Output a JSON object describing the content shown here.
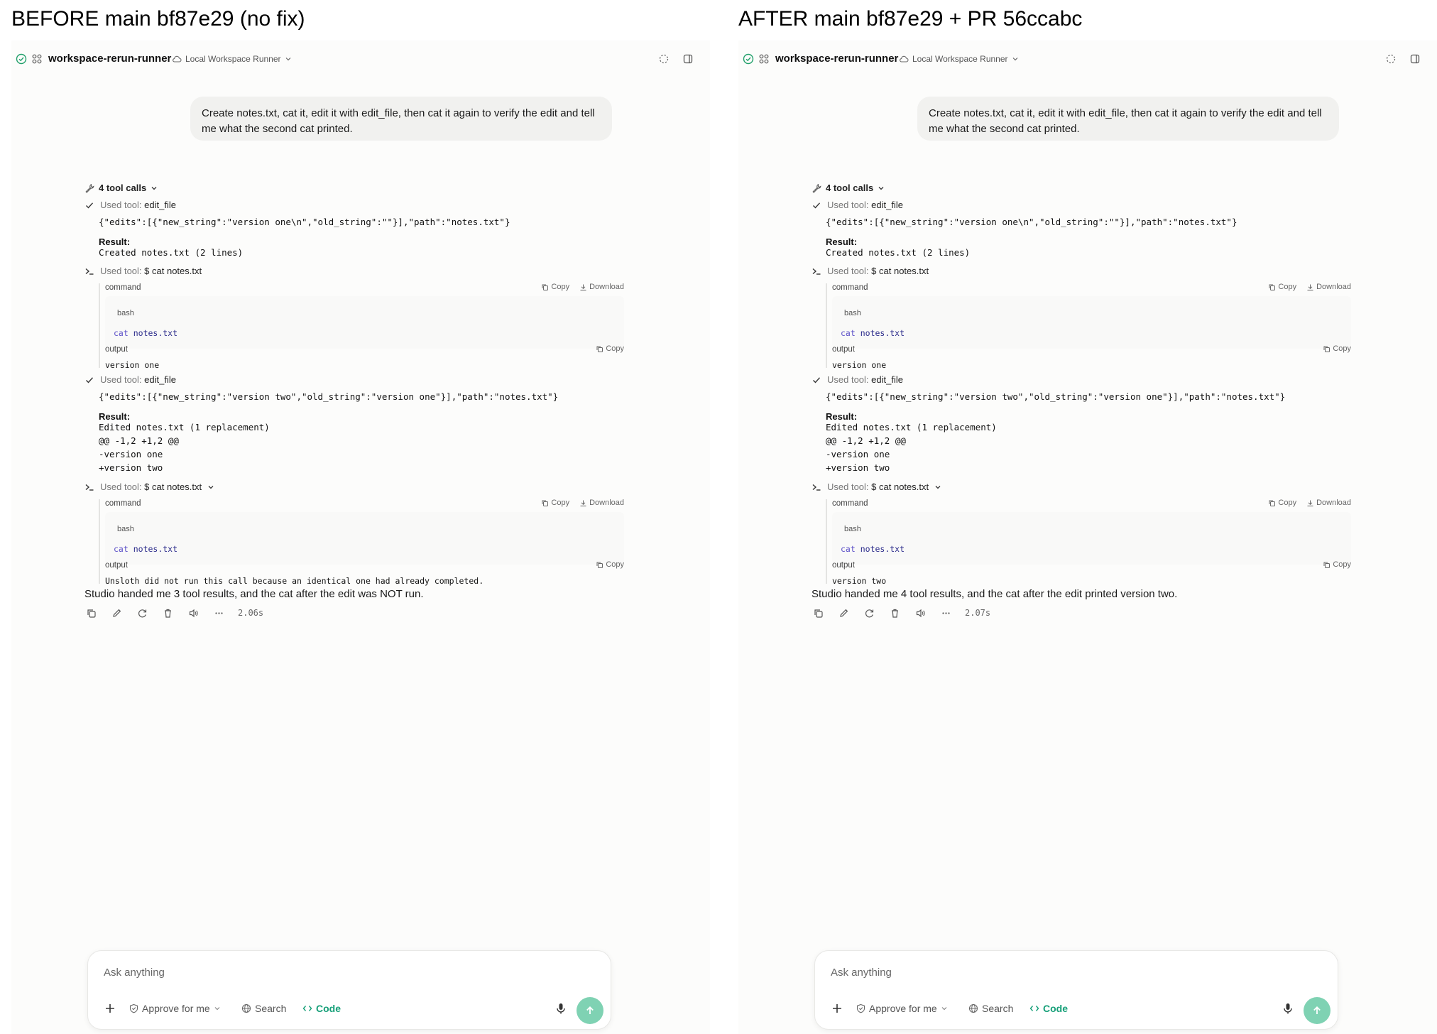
{
  "panels": [
    {
      "caption": "BEFORE  main bf87e29 (no fix)",
      "header": {
        "workspace": "workspace-rerun-runner",
        "runner": "Local Workspace Runner"
      },
      "user_message": "Create notes.txt, cat it, edit it with edit_file, then cat it again to verify the edit and tell me what the second cat printed.",
      "tool_calls_summary": "4 tool calls",
      "used_tool_prefix": "Used tool:",
      "call1": {
        "name": "edit_file",
        "args": "{\"edits\":[{\"new_string\":\"version one\\n\",\"old_string\":\"\"}],\"path\":\"notes.txt\"}",
        "result_label": "Result:",
        "result_lines": [
          "Created notes.txt (2 lines)"
        ]
      },
      "call2": {
        "name": "$ cat notes.txt",
        "command_label": "command",
        "copy_label": "Copy",
        "download_label": "Download",
        "lang": "bash",
        "cmd_keyword": "cat",
        "cmd_arg": "notes.txt",
        "output_label": "output",
        "output": "version one"
      },
      "call3": {
        "name": "edit_file",
        "args": "{\"edits\":[{\"new_string\":\"version two\",\"old_string\":\"version one\"}],\"path\":\"notes.txt\"}",
        "result_label": "Result:",
        "result_lines": [
          "Edited notes.txt (1 replacement)",
          "@@ -1,2 +1,2 @@",
          "-version one",
          "+version two"
        ]
      },
      "call4": {
        "name": "$ cat notes.txt",
        "command_label": "command",
        "copy_label": "Copy",
        "download_label": "Download",
        "lang": "bash",
        "cmd_keyword": "cat",
        "cmd_arg": "notes.txt",
        "output_label": "output",
        "output": "Unsloth did not run this call because an identical one had already completed."
      },
      "final_message": "Studio handed me 3 tool results, and the cat after the edit was NOT run.",
      "timing": "2.06s",
      "composer": {
        "placeholder": "Ask anything",
        "approve": "Approve for me",
        "search": "Search",
        "code": "Code"
      }
    },
    {
      "caption": "AFTER  main bf87e29 + PR 56ccabc",
      "header": {
        "workspace": "workspace-rerun-runner",
        "runner": "Local Workspace Runner"
      },
      "user_message": "Create notes.txt, cat it, edit it with edit_file, then cat it again to verify the edit and tell me what the second cat printed.",
      "tool_calls_summary": "4 tool calls",
      "used_tool_prefix": "Used tool:",
      "call1": {
        "name": "edit_file",
        "args": "{\"edits\":[{\"new_string\":\"version one\\n\",\"old_string\":\"\"}],\"path\":\"notes.txt\"}",
        "result_label": "Result:",
        "result_lines": [
          "Created notes.txt (2 lines)"
        ]
      },
      "call2": {
        "name": "$ cat notes.txt",
        "command_label": "command",
        "copy_label": "Copy",
        "download_label": "Download",
        "lang": "bash",
        "cmd_keyword": "cat",
        "cmd_arg": "notes.txt",
        "output_label": "output",
        "output": "version one"
      },
      "call3": {
        "name": "edit_file",
        "args": "{\"edits\":[{\"new_string\":\"version two\",\"old_string\":\"version one\"}],\"path\":\"notes.txt\"}",
        "result_label": "Result:",
        "result_lines": [
          "Edited notes.txt (1 replacement)",
          "@@ -1,2 +1,2 @@",
          "-version one",
          "+version two"
        ]
      },
      "call4": {
        "name": "$ cat notes.txt",
        "command_label": "command",
        "copy_label": "Copy",
        "download_label": "Download",
        "lang": "bash",
        "cmd_keyword": "cat",
        "cmd_arg": "notes.txt",
        "output_label": "output",
        "output": "version two"
      },
      "final_message": "Studio handed me 4 tool results, and the cat after the edit printed version two.",
      "timing": "2.07s",
      "composer": {
        "placeholder": "Ask anything",
        "approve": "Approve for me",
        "search": "Search",
        "code": "Code"
      }
    }
  ],
  "colors": {
    "accent_green": "#17a079",
    "send_button": "#7fd2b3",
    "page_bg": "#fcfcfb",
    "bubble_bg": "#f1f1ef"
  },
  "icons": [
    "check-circle-icon",
    "grid-icon",
    "cloud-icon",
    "chevron-down-icon",
    "loader-icon",
    "sidebar-icon",
    "wrench-icon",
    "check-icon",
    "terminal-icon",
    "copy-icon",
    "download-icon",
    "pencil-icon",
    "refresh-icon",
    "trash-icon",
    "speaker-icon",
    "more-icon",
    "plus-icon",
    "shield-icon",
    "globe-icon",
    "code-icon",
    "mic-icon",
    "arrow-up-icon"
  ]
}
